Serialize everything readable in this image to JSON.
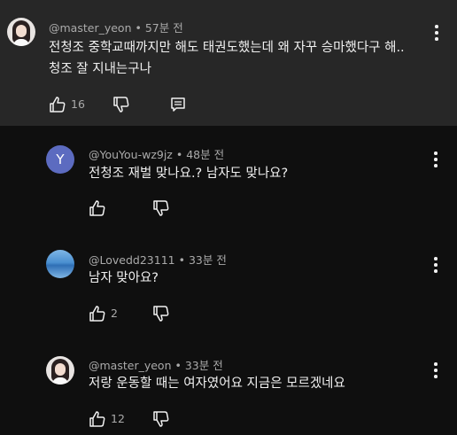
{
  "comments": [
    {
      "author": "@master_yeon",
      "time": "57분 전",
      "text_line1": "전청조 중학교때까지만 해도 태권도했는데 왜 자꾸 승마했다구 해..",
      "text_line2": "청조 잘 지내는구나",
      "likes": "16",
      "avatar": "girl-photo"
    },
    {
      "author": "@YouYou-wz9jz",
      "time": "48분 전",
      "text_line1": "전청조 재벌 맞나요.? 남자도 맞나요?",
      "likes": "",
      "avatar_letter": "Y",
      "avatar_color": "#5c6bc0"
    },
    {
      "author": "@Lovedd23111",
      "time": "33분 전",
      "text_line1": "남자 맞아요?",
      "likes": "2",
      "avatar": "sky-photo"
    },
    {
      "author": "@master_yeon",
      "time": "33분 전",
      "text_line1": "저랑 운동할 때는 여자였어요 지금은 모르겠네요",
      "likes": "12",
      "avatar": "girl-photo"
    }
  ],
  "meta_separator": "•",
  "icons": {
    "like": "thumb-up-icon",
    "dislike": "thumb-down-icon",
    "reply": "reply-icon",
    "more": "more-vert-icon"
  },
  "colors": {
    "background": "#0f0f0f",
    "highlight": "#272727",
    "text": "#f1f1f1",
    "muted": "#aaaaaa"
  }
}
